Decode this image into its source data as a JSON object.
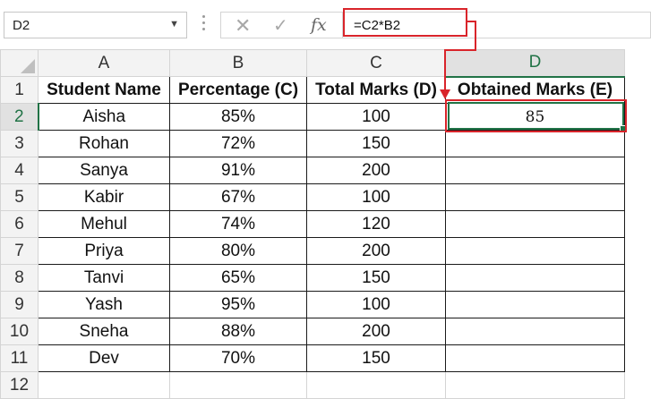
{
  "formula_bar": {
    "name_box": "D2",
    "name_box_arrow": "▼",
    "cancel_glyph": "✕",
    "enter_glyph": "✓",
    "fx_label": "fx",
    "formula": "=C2*B2"
  },
  "columns": [
    "A",
    "B",
    "C",
    "D"
  ],
  "rows": [
    "1",
    "2",
    "3",
    "4",
    "5",
    "6",
    "7",
    "8",
    "9",
    "10",
    "11",
    "12"
  ],
  "headers": [
    "Student Name",
    "Percentage (C)",
    "Total Marks (D)",
    "Obtained Marks (E)"
  ],
  "table": [
    {
      "name": "Aisha",
      "pct": "85%",
      "total": "100",
      "obtained": "85"
    },
    {
      "name": "Rohan",
      "pct": "72%",
      "total": "150",
      "obtained": ""
    },
    {
      "name": "Sanya",
      "pct": "91%",
      "total": "200",
      "obtained": ""
    },
    {
      "name": "Kabir",
      "pct": "67%",
      "total": "100",
      "obtained": ""
    },
    {
      "name": "Mehul",
      "pct": "74%",
      "total": "120",
      "obtained": ""
    },
    {
      "name": "Priya",
      "pct": "80%",
      "total": "200",
      "obtained": ""
    },
    {
      "name": "Tanvi",
      "pct": "65%",
      "total": "150",
      "obtained": ""
    },
    {
      "name": "Yash",
      "pct": "95%",
      "total": "100",
      "obtained": ""
    },
    {
      "name": "Sneha",
      "pct": "88%",
      "total": "200",
      "obtained": ""
    },
    {
      "name": "Dev",
      "pct": "70%",
      "total": "150",
      "obtained": ""
    }
  ],
  "selected_cell": "D2",
  "colors": {
    "annotation": "#d9242a",
    "selection": "#217346"
  }
}
